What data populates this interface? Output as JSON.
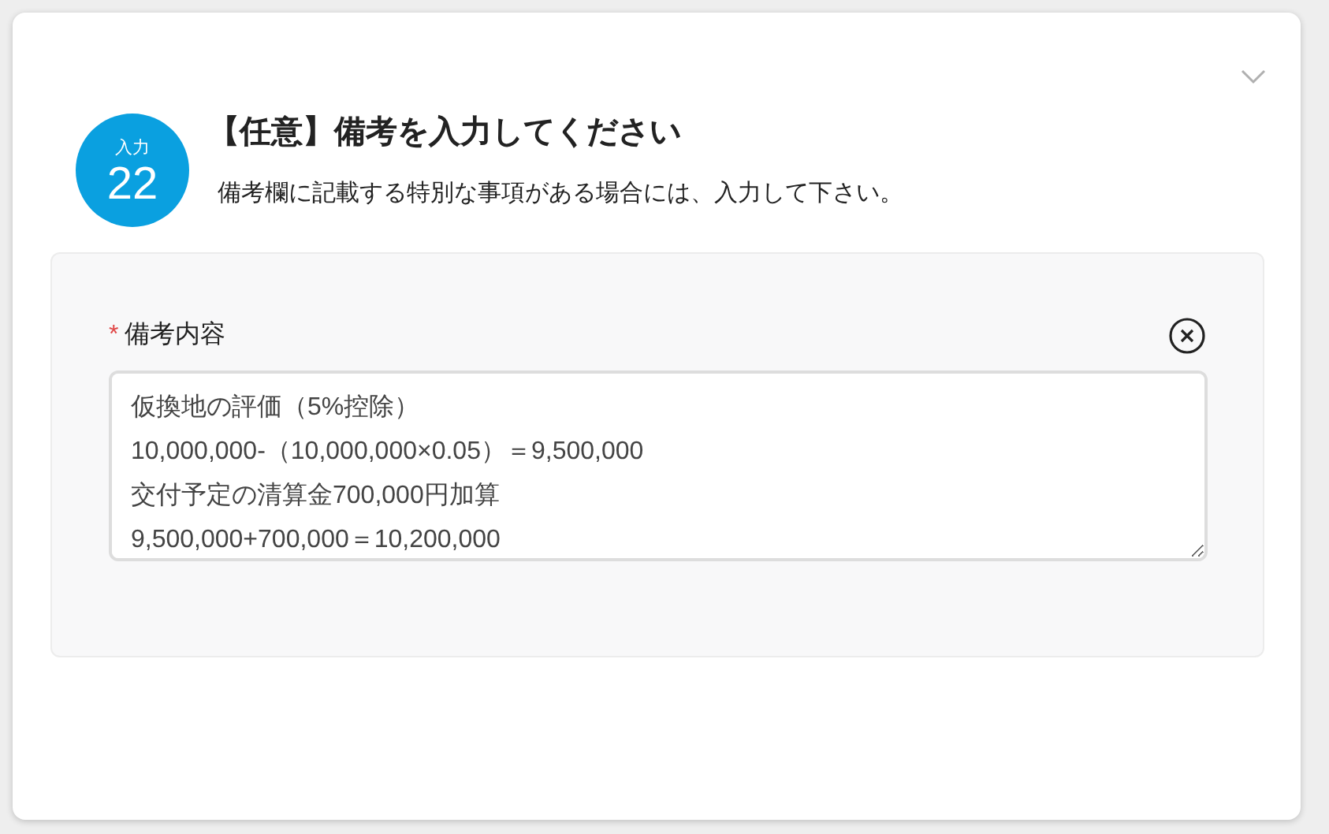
{
  "step": {
    "label": "入力",
    "number": "22"
  },
  "title": "【任意】備考を入力してください",
  "description": "備考欄に記載する特別な事項がある場合には、入力して下さい。",
  "field": {
    "label": "備考内容",
    "required_mark": "*",
    "value": "仮換地の評価（5%控除）\n10,000,000-（10,000,000×0.05）＝9,500,000\n交付予定の清算金700,000円加算\n9,500,000+700,000＝10,200,000"
  }
}
